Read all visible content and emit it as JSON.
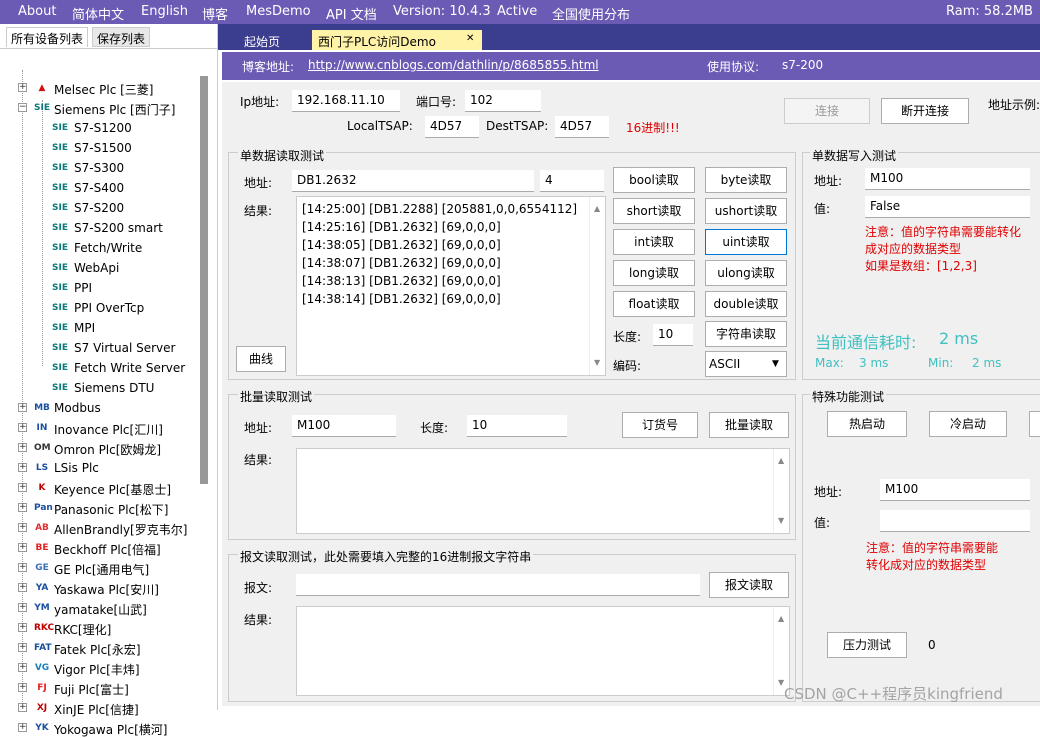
{
  "menu": {
    "about": "About",
    "lang_cn": "简体中文",
    "lang_en": "English",
    "blog": "博客",
    "mesdemo": "MesDemo",
    "api": "API 文档",
    "version": "Version: 10.4.3",
    "active": "Active",
    "distribution": "全国使用分布",
    "ram": "Ram: 58.2MB"
  },
  "left_tabs": {
    "all_devices": "所有设备列表",
    "saved": "保存列表"
  },
  "tree": {
    "melsec": "Melsec Plc [三菱]",
    "siemens": "Siemens Plc [西门子]",
    "children": [
      "S7-S1200",
      "S7-S1500",
      "S7-S300",
      "S7-S400",
      "S7-S200",
      "S7-S200 smart",
      "Fetch/Write",
      "WebApi",
      "PPI",
      "PPI OverTcp",
      "MPI",
      "S7 Virtual Server",
      "Fetch Write Server",
      "Siemens DTU"
    ],
    "siemens_icon": "SIE",
    "others": [
      {
        "label": "Modbus",
        "icon": "MB",
        "color": "#1a4fa0"
      },
      {
        "label": "Inovance Plc[汇川]",
        "icon": "IN",
        "color": "#1a4fa0"
      },
      {
        "label": "Omron Plc[欧姆龙]",
        "icon": "OM",
        "color": "#333333"
      },
      {
        "label": "LSis Plc",
        "icon": "LS",
        "color": "#1a4fa0"
      },
      {
        "label": "Keyence Plc[基恩士]",
        "icon": "K",
        "color": "#c00000"
      },
      {
        "label": "Panasonic Plc[松下]",
        "icon": "Pan",
        "color": "#1a4fa0"
      },
      {
        "label": "AllenBrandly[罗克韦尔]",
        "icon": "AB",
        "color": "#e03030"
      },
      {
        "label": "Beckhoff Plc[倍福]",
        "icon": "BE",
        "color": "#e02020"
      },
      {
        "label": "GE Plc[通用电气]",
        "icon": "GE",
        "color": "#3a6fc0"
      },
      {
        "label": "Yaskawa Plc[安川]",
        "icon": "YA",
        "color": "#1a4fa0"
      },
      {
        "label": "yamatake[山武]",
        "icon": "YM",
        "color": "#1a4fa0"
      },
      {
        "label": "RKC[理化]",
        "icon": "RKC",
        "color": "#c00000"
      },
      {
        "label": "Fatek Plc[永宏]",
        "icon": "FAT",
        "color": "#1a4fa0"
      },
      {
        "label": "Vigor Plc[丰炜]",
        "icon": "VG",
        "color": "#1a7fc0"
      },
      {
        "label": "Fuji Plc[富士]",
        "icon": "FJ",
        "color": "#e02020"
      },
      {
        "label": "XinJE Plc[信捷]",
        "icon": "XJ",
        "color": "#c00000"
      },
      {
        "label": "Yokogawa Plc[横河]",
        "icon": "YK",
        "color": "#1a4fa0"
      }
    ]
  },
  "tabs": {
    "home": "起始页",
    "siemens_demo": "西门子PLC访问Demo",
    "close": "✕"
  },
  "info": {
    "blog_label": "博客地址:",
    "blog_url": "http://www.cnblogs.com/dathlin/p/8685855.html",
    "protocol_label": "使用协议:",
    "protocol": "s7-200"
  },
  "conn": {
    "ip_label": "Ip地址:",
    "ip": "192.168.11.10",
    "port_label": "端口号:",
    "port": "102",
    "connect": "连接",
    "disconnect": "断开连接",
    "example_label": "地址示例:",
    "local_tsap_label": "LocalTSAP:",
    "local_tsap": "4D57",
    "dest_tsap_label": "DestTSAP:",
    "dest_tsap": "4D57",
    "hex_note": "16进制!!!"
  },
  "single_read": {
    "title": "单数据读取测试",
    "addr_label": "地址:",
    "addr": "DB1.2632",
    "length": "4",
    "result_label": "结果:",
    "curve": "曲线",
    "results": [
      "[14:25:00] [DB1.2288] [205881,0,0,6554112]",
      "[14:25:16] [DB1.2632] [69,0,0,0]",
      "[14:38:05] [DB1.2632] [69,0,0,0]",
      "[14:38:07] [DB1.2632] [69,0,0,0]",
      "[14:38:13] [DB1.2632] [69,0,0,0]",
      "[14:38:14] [DB1.2632] [69,0,0,0]"
    ],
    "bool": "bool读取",
    "byte": "byte读取",
    "short": "short读取",
    "ushort": "ushort读取",
    "int": "int读取",
    "uint": "uint读取",
    "long": "long读取",
    "ulong": "ulong读取",
    "float": "float读取",
    "double": "double读取",
    "len_label": "长度:",
    "len": "10",
    "string": "字符串读取",
    "enc_label": "编码:",
    "enc": "ASCII"
  },
  "single_write": {
    "title": "单数据写入测试",
    "addr_label": "地址:",
    "addr": "M100",
    "val_label": "值:",
    "val": "False",
    "note1": "注意：值的字符串需要能转化",
    "note2": "成对应的数据类型",
    "note3": "如果是数组：[1,2,3]",
    "timing_label": "当前通信耗时:",
    "timing": "2 ms",
    "max_label": "Max:",
    "max": "3 ms",
    "min_label": "Min:",
    "min": "2 ms"
  },
  "batch": {
    "title": "批量读取测试",
    "addr_label": "地址:",
    "addr": "M100",
    "len_label": "长度:",
    "len": "10",
    "order": "订货号",
    "read": "批量读取",
    "result_label": "结果:"
  },
  "message": {
    "title": "报文读取测试，此处需要填入完整的16进制报文字符串",
    "msg_label": "报文:",
    "read": "报文读取",
    "result_label": "结果:"
  },
  "special": {
    "title": "特殊功能测试",
    "hot": "热启动",
    "cold": "冷启动",
    "addr_label": "地址:",
    "addr": "M100",
    "val_label": "值:",
    "note1": "注意：值的字符串需要能",
    "note2": "转化成对应的数据类型",
    "stress": "压力测试",
    "count": "0"
  },
  "watermark": "CSDN @C++程序员kingfriend"
}
